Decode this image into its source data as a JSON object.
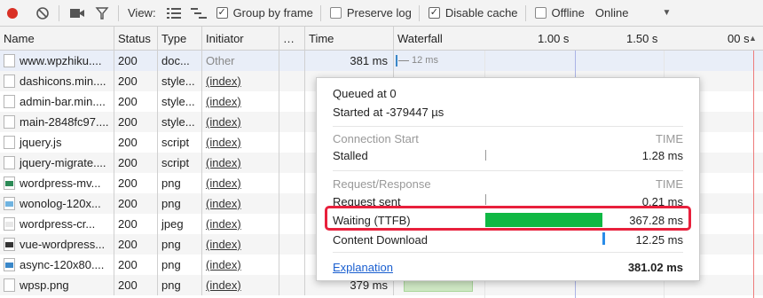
{
  "toolbar": {
    "view_label": "View:",
    "group_by_frame": "Group by frame",
    "preserve_log": "Preserve log",
    "disable_cache": "Disable cache",
    "offline": "Offline",
    "throttle": "Online"
  },
  "columns": {
    "name": "Name",
    "status": "Status",
    "type": "Type",
    "initiator": "Initiator",
    "more": "…",
    "time": "Time",
    "waterfall": "Waterfall",
    "tick1": "1.00 s",
    "tick2": "1.50 s",
    "tick3": "00 s"
  },
  "rows": [
    {
      "name": "www.wpzhiku....",
      "status": "200",
      "type": "doc...",
      "initiator": "Other",
      "time": "381 ms",
      "bar_label": "12 ms"
    },
    {
      "name": "dashicons.min....",
      "status": "200",
      "type": "style...",
      "initiator": "(index)"
    },
    {
      "name": "admin-bar.min....",
      "status": "200",
      "type": "style...",
      "initiator": "(index)"
    },
    {
      "name": "main-2848fc97....",
      "status": "200",
      "type": "style...",
      "initiator": "(index)"
    },
    {
      "name": "jquery.js",
      "status": "200",
      "type": "script",
      "initiator": "(index)"
    },
    {
      "name": "jquery-migrate....",
      "status": "200",
      "type": "script",
      "initiator": "(index)"
    },
    {
      "name": "wordpress-mv...",
      "status": "200",
      "type": "png",
      "initiator": "(index)"
    },
    {
      "name": "wonolog-120x...",
      "status": "200",
      "type": "png",
      "initiator": "(index)"
    },
    {
      "name": "wordpress-cr...",
      "status": "200",
      "type": "jpeg",
      "initiator": "(index)"
    },
    {
      "name": "vue-wordpress...",
      "status": "200",
      "type": "png",
      "initiator": "(index)"
    },
    {
      "name": "async-120x80....",
      "status": "200",
      "type": "png",
      "initiator": "(index)"
    },
    {
      "name": "wpsp.png",
      "status": "200",
      "type": "png",
      "initiator": "(index)",
      "time": "379 ms"
    }
  ],
  "popup": {
    "queued": "Queued at 0",
    "started": "Started at -379447 µs",
    "section1": "Connection Start",
    "section1_time": "TIME",
    "stalled_label": "Stalled",
    "stalled_value": "1.28 ms",
    "section2": "Request/Response",
    "section2_time": "TIME",
    "request_sent_label": "Request sent",
    "request_sent_value": "0.21 ms",
    "waiting_label": "Waiting (TTFB)",
    "waiting_value": "367.28 ms",
    "download_label": "Content Download",
    "download_value": "12.25 ms",
    "explanation": "Explanation",
    "total": "381.02 ms"
  },
  "colors": {
    "record": "#d93025",
    "waiting_bar": "#10b844",
    "download_bar": "#2a8ce8",
    "highlight": "#e8203c",
    "selected_row": "#e9eef8"
  }
}
